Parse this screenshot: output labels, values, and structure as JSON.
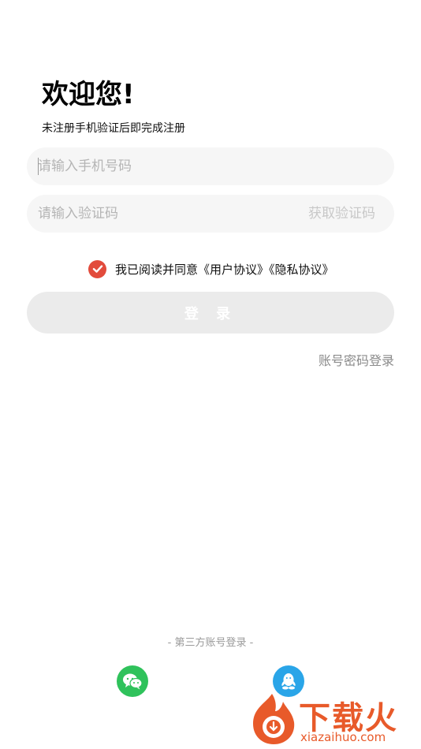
{
  "header": {
    "title": "欢迎您!",
    "subtitle": "未注册手机验证后即完成注册"
  },
  "phone": {
    "placeholder": "请输入手机号码",
    "value": ""
  },
  "code": {
    "placeholder": "请输入验证码",
    "value": "",
    "get_code_label": "获取验证码"
  },
  "agreement": {
    "checked": true,
    "text": "我已阅读并同意《用户协议》《隐私协议》"
  },
  "login_button": {
    "label": "登 录"
  },
  "password_login": {
    "label": "账号密码登录"
  },
  "third_party": {
    "label": "- 第三方账号登录 -",
    "providers": [
      "wechat-icon",
      "qq-icon"
    ]
  },
  "watermark": {
    "text": "下载火",
    "domain": "xiazaihuo.com"
  },
  "colors": {
    "accent_red": "#e24b3c",
    "wechat_green": "#2fc25b",
    "qq_blue": "#2aa5e8",
    "watermark_orange": "#e85a2a"
  }
}
